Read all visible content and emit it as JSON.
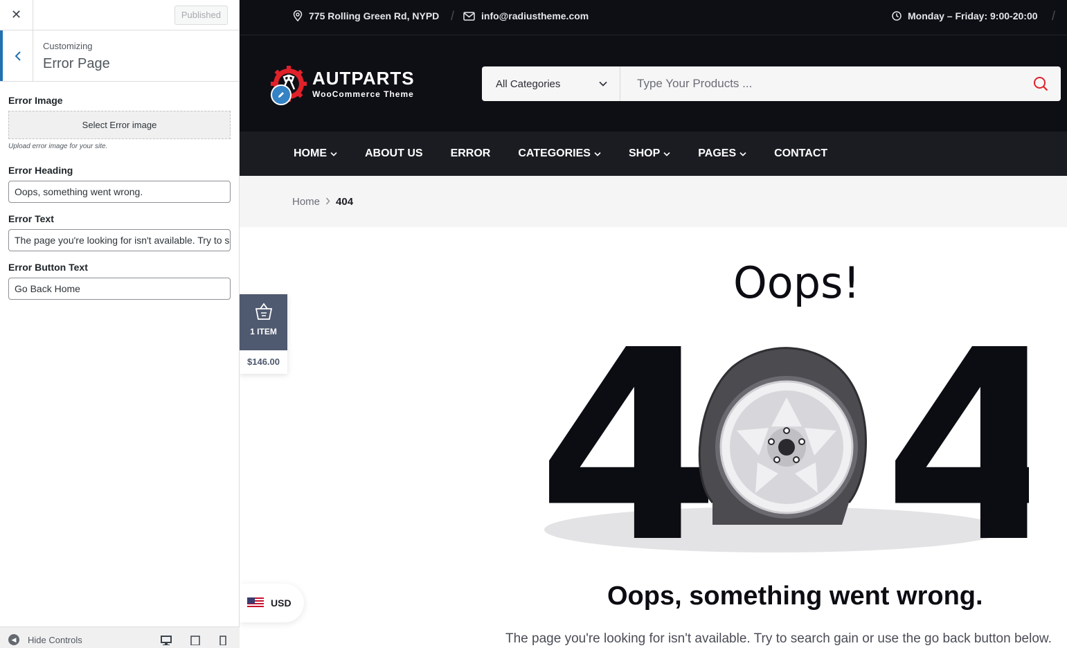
{
  "customizer": {
    "close_label": "✕",
    "published_label": "Published",
    "breadcrumb_label": "Customizing",
    "section_title": "Error Page",
    "fields": {
      "image_label": "Error Image",
      "image_button": "Select Error image",
      "image_hint": "Upload error image for your site.",
      "heading_label": "Error Heading",
      "heading_value": "Oops, something went wrong.",
      "text_label": "Error Text",
      "text_value": "The page you're looking for isn't available. Try to search gain or use the go back button below.",
      "button_label": "Error Button Text",
      "button_value": "Go Back Home"
    },
    "footer": {
      "hide_controls": "Hide Controls"
    }
  },
  "site": {
    "topbar": {
      "address": "775 Rolling Green Rd, NYPD",
      "email": "info@radiustheme.com",
      "hours": "Monday – Friday: 9:00-20:00"
    },
    "logo": {
      "title": "AUTPARTS",
      "subtitle": "WooCommerce Theme"
    },
    "search": {
      "category": "All Categories",
      "placeholder": "Type Your Products ..."
    },
    "nav": [
      {
        "label": "HOME",
        "dropdown": true
      },
      {
        "label": "ABOUT US",
        "dropdown": false
      },
      {
        "label": "ERROR",
        "dropdown": false
      },
      {
        "label": "CATEGORIES",
        "dropdown": true
      },
      {
        "label": "SHOP",
        "dropdown": true
      },
      {
        "label": "PAGES",
        "dropdown": true
      },
      {
        "label": "CONTACT",
        "dropdown": false
      }
    ],
    "breadcrumb": {
      "home": "Home",
      "current": "404"
    },
    "error": {
      "oops": "Oops!",
      "big_code_left": "4",
      "big_code_right": "4",
      "heading": "Oops, something went wrong.",
      "text": "The page you're looking for isn't available. Try to search gain or use the go back button below."
    },
    "cart": {
      "count": "1 ITEM",
      "total": "$146.00"
    },
    "currency": {
      "code": "USD"
    }
  },
  "colors": {
    "dark_bg": "#0e0f15",
    "nav_bg": "#1b1c22",
    "accent_red": "#e0212a",
    "wp_blue": "#2271b1",
    "cart_bg": "#4f596f"
  }
}
